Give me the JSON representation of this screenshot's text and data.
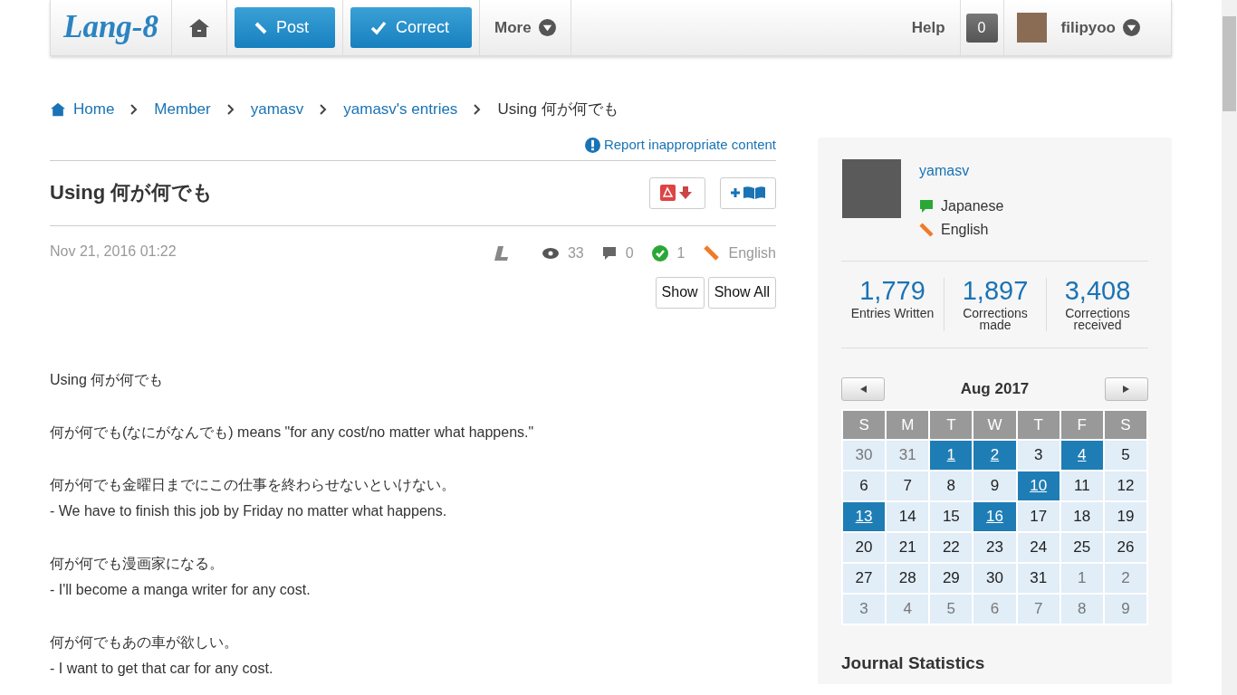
{
  "navbar": {
    "logo": "Lang-8",
    "post_button": "Post",
    "correct_button": "Correct",
    "more_menu": "More",
    "help_link": "Help",
    "notification_count": "0",
    "username": "filipyoo"
  },
  "breadcrumb": [
    "Home",
    "Member",
    "yamasv",
    "yamasv's entries",
    "Using 何が何でも"
  ],
  "report_link": "Report inappropriate content",
  "entry": {
    "title": "Using 何が何でも",
    "date": "Nov 21, 2016 01:22",
    "views": "33",
    "comments": "0",
    "corrections": "1",
    "language": "English",
    "show_button": "Show",
    "show_all_button": "Show All",
    "paragraphs": [
      [
        "Using 何が何でも"
      ],
      [
        "何が何でも(なにがなんでも) means \"for any cost/no matter what happens.\""
      ],
      [
        "何が何でも金曜日までにこの仕事を終わらせないといけない。",
        "- We have to finish this job by Friday no matter what happens."
      ],
      [
        "何が何でも漫画家になる。",
        "- I'll become a manga writer for any cost."
      ],
      [
        "何が何でもあの車が欲しい。",
        "- I want to get that car for any cost."
      ]
    ]
  },
  "profile": {
    "username": "yamasv",
    "native_language": "Japanese",
    "learning_language": "English",
    "stats": [
      {
        "value": "1,779",
        "label": "Entries Written"
      },
      {
        "value": "1,897",
        "label": "Corrections made"
      },
      {
        "value": "3,408",
        "label": "Corrections received"
      }
    ]
  },
  "calendar": {
    "month": "Aug 2017",
    "weekdays": [
      "S",
      "M",
      "T",
      "W",
      "T",
      "F",
      "S"
    ],
    "days": [
      {
        "day": "30",
        "kind": "other",
        "has_entry": false
      },
      {
        "day": "31",
        "kind": "other",
        "has_entry": false
      },
      {
        "day": "1",
        "kind": "current",
        "has_entry": true
      },
      {
        "day": "2",
        "kind": "current",
        "has_entry": true
      },
      {
        "day": "3",
        "kind": "current",
        "has_entry": false
      },
      {
        "day": "4",
        "kind": "current",
        "has_entry": true
      },
      {
        "day": "5",
        "kind": "current",
        "has_entry": false
      },
      {
        "day": "6",
        "kind": "current",
        "has_entry": false
      },
      {
        "day": "7",
        "kind": "current",
        "has_entry": false
      },
      {
        "day": "8",
        "kind": "current",
        "has_entry": false
      },
      {
        "day": "9",
        "kind": "current",
        "has_entry": false
      },
      {
        "day": "10",
        "kind": "current",
        "has_entry": true
      },
      {
        "day": "11",
        "kind": "current",
        "has_entry": false
      },
      {
        "day": "12",
        "kind": "current",
        "has_entry": false
      },
      {
        "day": "13",
        "kind": "current",
        "has_entry": true
      },
      {
        "day": "14",
        "kind": "current",
        "has_entry": false
      },
      {
        "day": "15",
        "kind": "current",
        "has_entry": false
      },
      {
        "day": "16",
        "kind": "current",
        "has_entry": true
      },
      {
        "day": "17",
        "kind": "current",
        "has_entry": false
      },
      {
        "day": "18",
        "kind": "current",
        "has_entry": false
      },
      {
        "day": "19",
        "kind": "current",
        "has_entry": false
      },
      {
        "day": "20",
        "kind": "current",
        "has_entry": false
      },
      {
        "day": "21",
        "kind": "current",
        "has_entry": false
      },
      {
        "day": "22",
        "kind": "current",
        "has_entry": false
      },
      {
        "day": "23",
        "kind": "current",
        "has_entry": false
      },
      {
        "day": "24",
        "kind": "current",
        "has_entry": false
      },
      {
        "day": "25",
        "kind": "current",
        "has_entry": false
      },
      {
        "day": "26",
        "kind": "current",
        "has_entry": false
      },
      {
        "day": "27",
        "kind": "current",
        "has_entry": false
      },
      {
        "day": "28",
        "kind": "current",
        "has_entry": false
      },
      {
        "day": "29",
        "kind": "current",
        "has_entry": false
      },
      {
        "day": "30",
        "kind": "current",
        "has_entry": false
      },
      {
        "day": "31",
        "kind": "current",
        "has_entry": false
      },
      {
        "day": "1",
        "kind": "other",
        "has_entry": false
      },
      {
        "day": "2",
        "kind": "other",
        "has_entry": false
      },
      {
        "day": "3",
        "kind": "other",
        "has_entry": false
      },
      {
        "day": "4",
        "kind": "other",
        "has_entry": false
      },
      {
        "day": "5",
        "kind": "other",
        "has_entry": false
      },
      {
        "day": "6",
        "kind": "other",
        "has_entry": false
      },
      {
        "day": "7",
        "kind": "other",
        "has_entry": false
      },
      {
        "day": "8",
        "kind": "other",
        "has_entry": false
      },
      {
        "day": "9",
        "kind": "other",
        "has_entry": false
      }
    ]
  },
  "journal_statistics_heading": "Journal Statistics"
}
